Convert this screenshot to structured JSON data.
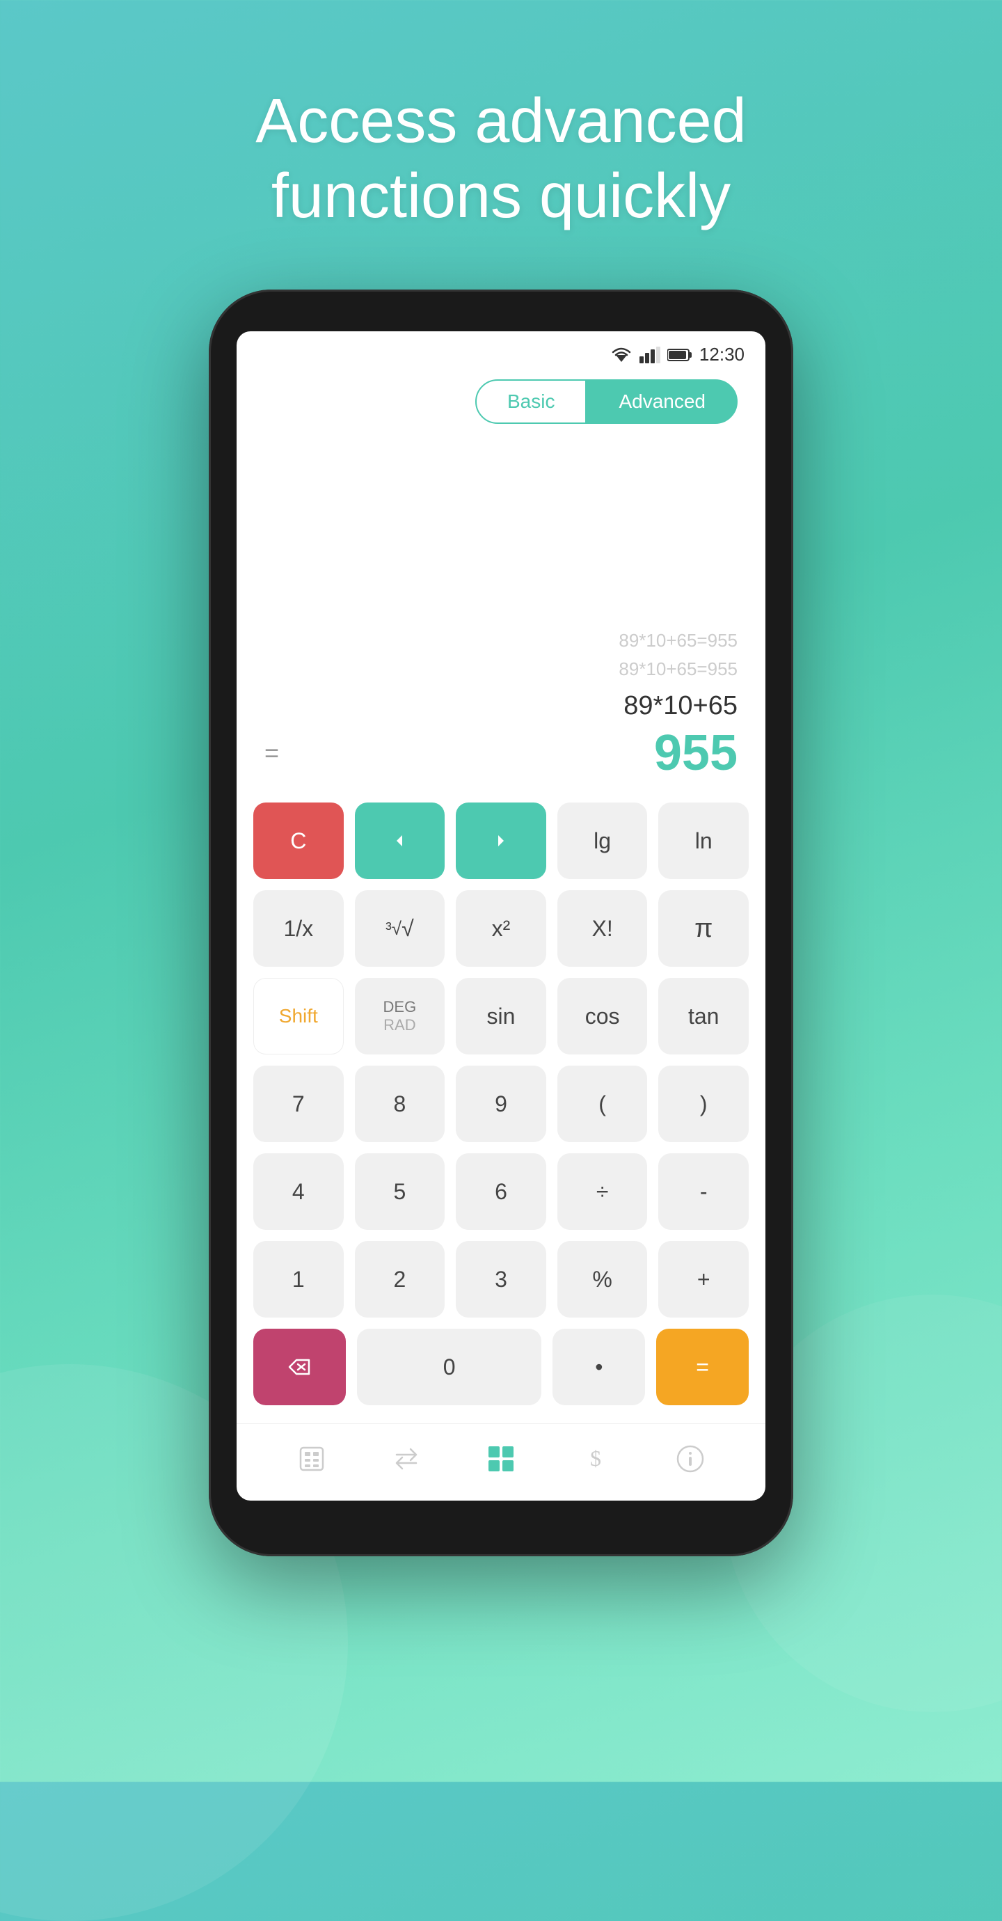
{
  "headline": {
    "line1": "Access advanced",
    "line2": "functions quickly"
  },
  "statusBar": {
    "time": "12:30"
  },
  "tabs": {
    "basic": "Basic",
    "advanced": "Advanced"
  },
  "display": {
    "history1": "89*10+65=955",
    "history2": "89*10+65=955",
    "expression": "89*10+65",
    "equals": "=",
    "result": "955"
  },
  "keypad": {
    "row1": [
      "C",
      "‹",
      "›",
      "lg",
      "ln"
    ],
    "row2": [
      "1/x",
      "³√",
      "x²",
      "X!",
      "π"
    ],
    "row3": [
      "Shift",
      "DEG\nRAD",
      "sin",
      "cos",
      "tan"
    ],
    "row4": [
      "7",
      "8",
      "9",
      "(",
      ")"
    ],
    "row5": [
      "4",
      "5",
      "6",
      "÷",
      "-"
    ],
    "row6": [
      "1",
      "2",
      "3",
      "%",
      "+"
    ],
    "row7": [
      "⌫",
      "0",
      "•",
      "="
    ]
  },
  "bottomNav": {
    "items": [
      "calc",
      "convert",
      "advanced",
      "currency",
      "info"
    ]
  }
}
